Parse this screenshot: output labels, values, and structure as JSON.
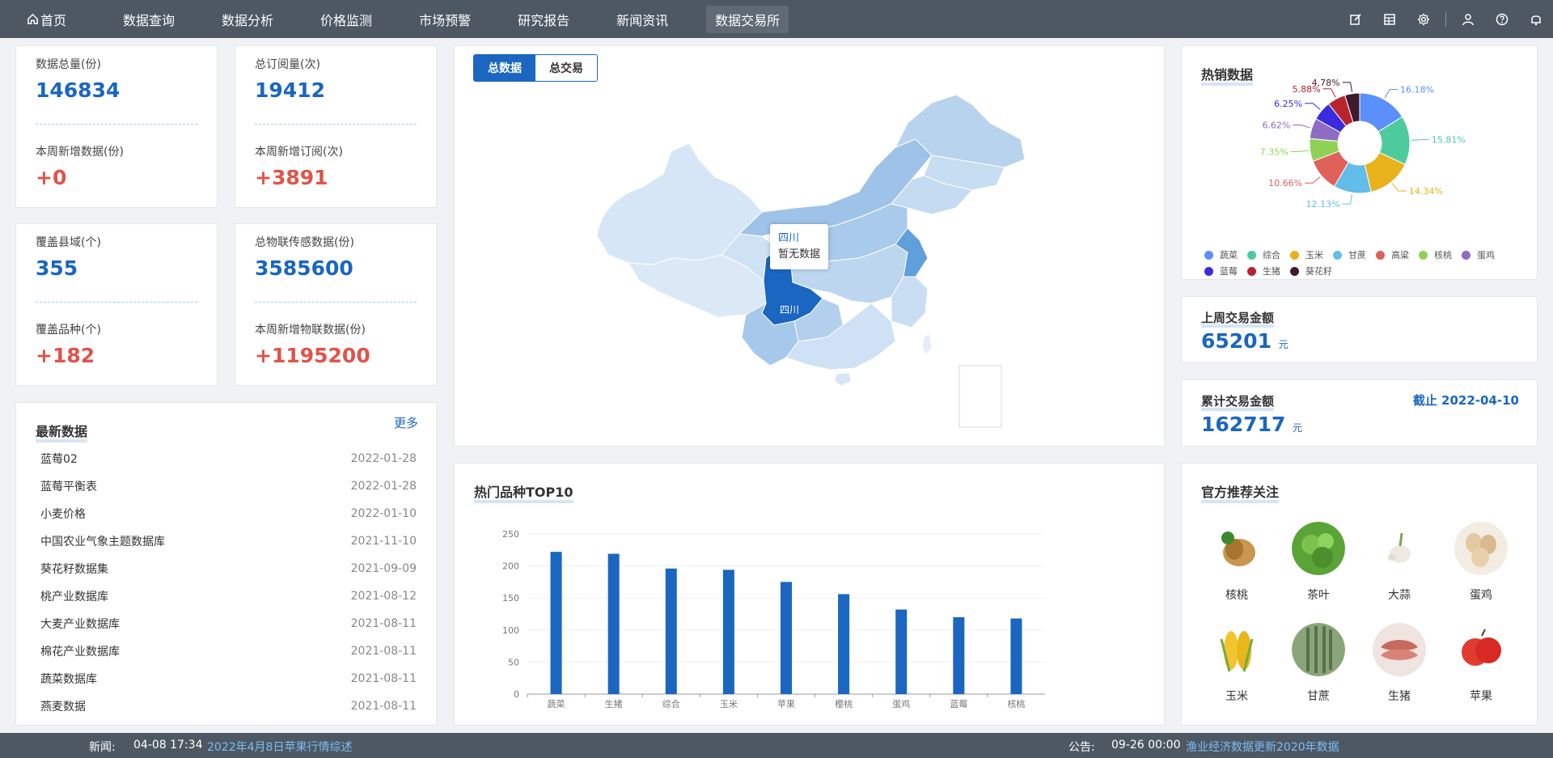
{
  "nav": {
    "items": [
      "首页",
      "数据查询",
      "数据分析",
      "价格监测",
      "市场预警",
      "研究报告",
      "新闻资讯",
      "数据交易所"
    ],
    "active": "数据交易所",
    "icons": [
      "edit-icon",
      "table-icon",
      "settings-icon",
      "user-icon",
      "help-icon",
      "notification-icon"
    ]
  },
  "stats": {
    "total_data": {
      "label": "数据总量(份)",
      "value": "146834"
    },
    "weekly_new_data": {
      "label": "本周新增数据(份)",
      "value": "+0"
    },
    "total_subscriptions": {
      "label": "总订阅量(次)",
      "value": "19412"
    },
    "weekly_new_subscriptions": {
      "label": "本周新增订阅(次)",
      "value": "+3891"
    },
    "counties": {
      "label": "覆盖县域(个)",
      "value": "355"
    },
    "varieties": {
      "label": "覆盖品种(个)",
      "value": "+182"
    },
    "iot_data": {
      "label": "总物联传感数据(份)",
      "value": "3585600"
    },
    "weekly_new_iot": {
      "label": "本周新增物联数据(份)",
      "value": "+1195200"
    }
  },
  "latest": {
    "title": "最新数据",
    "more": "更多",
    "rows": [
      {
        "name": "蓝莓02",
        "date": "2022-01-28"
      },
      {
        "name": "蓝莓平衡表",
        "date": "2022-01-28"
      },
      {
        "name": "小麦价格",
        "date": "2022-01-10"
      },
      {
        "name": "中国农业气象主题数据库",
        "date": "2021-11-10"
      },
      {
        "name": "葵花籽数据集",
        "date": "2021-09-09"
      },
      {
        "name": "桃产业数据库",
        "date": "2021-08-12"
      },
      {
        "name": "大麦产业数据库",
        "date": "2021-08-11"
      },
      {
        "name": "棉花产业数据库",
        "date": "2021-08-11"
      },
      {
        "name": "蔬菜数据库",
        "date": "2021-08-11"
      },
      {
        "name": "燕麦数据",
        "date": "2021-08-11"
      }
    ]
  },
  "map": {
    "tabs": [
      "总数据",
      "总交易"
    ],
    "active_tab": "总数据",
    "highlight_label": "四川",
    "tooltip_title": "四川",
    "tooltip_value": "暂无数据"
  },
  "hot_data": {
    "title": "热销数据",
    "pie_labels": [
      "16.18%",
      "15.81%",
      "14.34%",
      "12.13%",
      "10.66%",
      "7.35%",
      "6.62%",
      "6.25%",
      "5.88%",
      "4.78%"
    ],
    "legend": [
      "蔬菜",
      "综合",
      "玉米",
      "甘蔗",
      "高粱",
      "核桃",
      "蛋鸡",
      "蓝莓",
      "生猪",
      "葵花籽"
    ],
    "colors": [
      "#5b8ff9",
      "#4ecb9c",
      "#e8b21c",
      "#62bde9",
      "#e0605a",
      "#8fd154",
      "#8e6cc4",
      "#3a2bdc",
      "#b72430",
      "#3d1b2c"
    ]
  },
  "trade": {
    "last_week_label": "上周交易金额",
    "last_week_value": "65201",
    "unit": "元",
    "total_label": "累计交易金额",
    "total_value": "162717",
    "as_of": "截止 2022-04-10"
  },
  "top10": {
    "title": "热门品种TOP10"
  },
  "chart_data": {
    "type": "bar",
    "title": "热门品种TOP10",
    "categories": [
      "蔬菜",
      "生猪",
      "综合",
      "玉米",
      "苹果",
      "樱桃",
      "蛋鸡",
      "蓝莓",
      "核桃"
    ],
    "values": [
      222,
      219,
      196,
      194,
      175,
      156,
      132,
      120,
      118
    ],
    "ylim": [
      0,
      250
    ],
    "yticks": [
      0,
      50,
      100,
      150,
      200,
      250
    ],
    "color": "#1a66c0"
  },
  "recommend": {
    "title": "官方推荐关注",
    "items": [
      {
        "name": "核桃",
        "icon": "walnut-icon"
      },
      {
        "name": "茶叶",
        "icon": "tea-icon"
      },
      {
        "name": "大蒜",
        "icon": "garlic-icon"
      },
      {
        "name": "蛋鸡",
        "icon": "egg-icon"
      },
      {
        "name": "玉米",
        "icon": "corn-icon"
      },
      {
        "name": "甘蔗",
        "icon": "sugarcane-icon"
      },
      {
        "name": "生猪",
        "icon": "pork-icon"
      },
      {
        "name": "苹果",
        "icon": "apple-icon"
      }
    ]
  },
  "footer": {
    "news_label": "新闻:",
    "news_time": "04-08 17:34",
    "news_title": "2022年4月8日苹果行情综述",
    "notice_label": "公告:",
    "notice_time": "09-26 00:00",
    "notice_title": "渔业经济数据更新2020年数据"
  }
}
